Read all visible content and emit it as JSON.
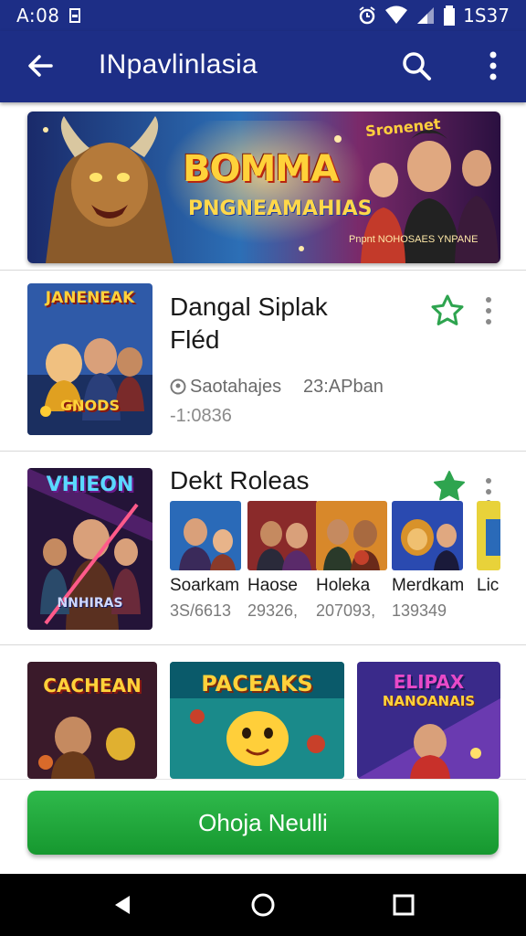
{
  "status_bar": {
    "time": "A:08",
    "clock": "1S37",
    "icons": [
      "notification-square-icon",
      "alarm-icon",
      "wifi-icon",
      "signal-icon",
      "battery-icon"
    ]
  },
  "app_bar": {
    "title": "INpavlinlasia",
    "icons": [
      "back-arrow-icon",
      "search-icon",
      "more-vertical-icon"
    ]
  },
  "banner": {
    "title": "BOMMA",
    "subtitle": "PNGNEAMAHIAS",
    "tag": "Sronenet",
    "small_text": "Pnpnt NOHOSAES YNPANE"
  },
  "card1": {
    "art_title": "JANENEAK",
    "art_sub": "GNODS",
    "title_line1": "Dangal Siplak",
    "title_line2": "Fléd",
    "meta_left": "Saotahajes",
    "meta_right": "23:APban",
    "meta_count": "-1:0836"
  },
  "card2": {
    "art_title": "VHIEON",
    "art_sub": "NNHIRAS",
    "title": "Dekt Roleas",
    "items": [
      {
        "name": "Soarkam",
        "count": "3S/6613"
      },
      {
        "name": "Haose",
        "count": "29326,"
      },
      {
        "name": "Holeka",
        "count": "207093,"
      },
      {
        "name": "Merdkam",
        "count": "139349"
      },
      {
        "name": "Lic",
        "count": ""
      }
    ]
  },
  "row3": [
    {
      "title": "CACHEAN"
    },
    {
      "title": "PACEAKS"
    },
    {
      "title": "ELIPAX",
      "subtitle": "NANOANAIS"
    }
  ],
  "cta": {
    "label": "Ohoja Neulli"
  },
  "colors": {
    "primary": "#1d2e86",
    "accent_green": "#1ea83a",
    "star_green": "#2ea44f"
  },
  "nav_bar": {
    "icons": [
      "back-triangle-icon",
      "home-circle-icon",
      "recents-square-icon"
    ]
  }
}
